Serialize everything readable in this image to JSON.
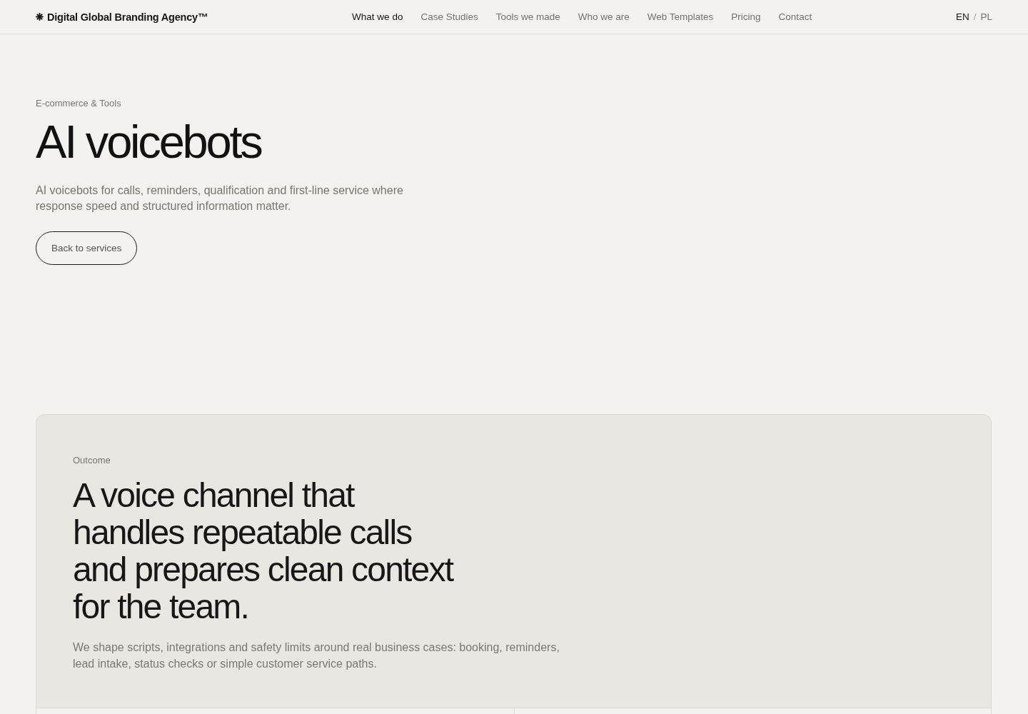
{
  "header": {
    "logo": "Digital Global Branding Agency™",
    "nav": [
      {
        "label": "What we do",
        "selected": true
      },
      {
        "label": "Case Studies",
        "selected": false
      },
      {
        "label": "Tools we made",
        "selected": false
      },
      {
        "label": "Who we are",
        "selected": false
      },
      {
        "label": "Web Templates",
        "selected": false
      },
      {
        "label": "Pricing",
        "selected": false
      },
      {
        "label": "Contact",
        "selected": false
      }
    ],
    "languages": [
      {
        "label": "EN",
        "selected": true
      },
      {
        "label": "PL",
        "selected": false
      }
    ],
    "language_separator": "/"
  },
  "hero": {
    "eyebrow": "E-commerce & Tools",
    "title": "AI voicebots",
    "description": "AI voicebots for calls, reminders, qualification and first-line service where response speed and structured information matter.",
    "button": "Back to services"
  },
  "outcome": {
    "eyebrow": "Outcome",
    "heading": "A voice channel that handles repeatable calls and prepares clean context for the team.",
    "description": "We shape scripts, integrations and safety limits around real business cases: booking, reminders, lead intake, status checks or simple customer service paths."
  }
}
